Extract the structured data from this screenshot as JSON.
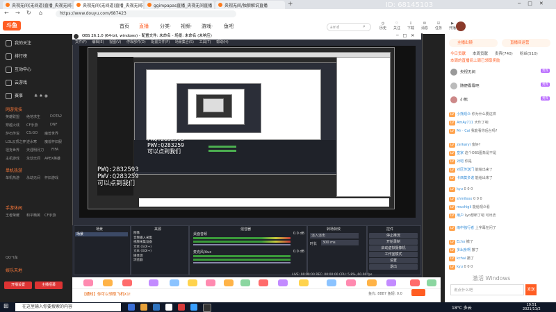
{
  "browser": {
    "tabs": [
      {
        "label": "央视无间(无间道)直播_央视无间视频直播"
      },
      {
        "label": "央视无间(无间道)直播_央视无间视频直播 ×"
      },
      {
        "label": "ggimpapas直播_央视无间直播"
      },
      {
        "label": "央视无间/独狼解说直播"
      }
    ],
    "address": "https://www.douyu.com/687423",
    "watermark": "ID: 68145103"
  },
  "site_header": {
    "logo": "斗鱼",
    "nav": [
      "首页",
      "直播",
      "分类·",
      "视频·",
      "游戏·",
      "鱼吧"
    ],
    "active_nav": "直播",
    "search_placeholder": "amd",
    "icons": [
      "历史",
      "关注",
      "下载",
      "消息",
      "任务",
      "开播"
    ]
  },
  "sidebar": {
    "items": [
      "我的关注",
      "排行榜",
      "互动中心",
      "云游戏",
      "赛事"
    ],
    "heads": [
      "网游竞技",
      "单机热游",
      "手游休闲",
      "娱乐天地"
    ],
    "games": [
      "英雄联盟",
      "绝地求生",
      "DOTA2",
      "穿越火线",
      "CF手游",
      "DNF",
      "炉石传说",
      "CS:GO",
      "魔兽世界",
      "LOL云顶之弈",
      "逆水寒",
      "魔兽怀旧服",
      "坦克世界",
      "天涯明月刀",
      "FIFA",
      "主机游戏",
      "永劫无间",
      "怀旧游戏",
      "APEX英雄",
      "单机热游",
      "CF手游",
      "和平精英",
      "王者荣耀",
      "QQ飞车"
    ],
    "buttons": [
      "开播设置",
      "主播招募"
    ]
  },
  "obs": {
    "title": "OBS 26.1.0 (64-bit, windows) - 配置文件: 未命名 - 场景: 未命名",
    "menu": [
      "文件(F)",
      "编辑(E)",
      "视图(V)",
      "停靠部件(D)",
      "配置文件(P)",
      "场景集合(S)",
      "工具(T)",
      "帮助(H)"
    ],
    "dock_titles": [
      "场景",
      "来源",
      "混音器",
      "转场特效",
      "控件"
    ],
    "scene": "场景",
    "sources": [
      "图像",
      "音频输入采集",
      "视频采集设备",
      "文本 (GDI+)",
      "文本 (GDI+)",
      "媒体源",
      "浏览器"
    ],
    "mixer": [
      {
        "name": "桌面音频",
        "level": "0.0 dB"
      },
      {
        "name": "麦克风/Aux",
        "level": "0.0 dB"
      }
    ],
    "transition": "淡入淡出",
    "duration_label": "时长",
    "duration": "300 ms",
    "controls": [
      "停止推流",
      "开始录制",
      "启动虚拟摄像机",
      "工作室模式",
      "设置",
      "退出"
    ],
    "status": "LIVE: 00:00:00  REC: 00:00:00  CPU: 5.8%, 60.00 fps",
    "not_responding": "(未响应)"
  },
  "overlay": {
    "lines": [
      "PWQ:2832593",
      "PWV:Q283259",
      "可以点到我们"
    ]
  },
  "chat": {
    "top_tabs": [
      "主播出镜",
      "直播间运营"
    ],
    "tabs": [
      "今日贡献",
      "本周贡献",
      "贵宾(740)",
      "粉丝(510)"
    ],
    "active_tab": "今日贡献",
    "ranks": [
      {
        "name": "本周的直播间上周已领取奖励",
        "level": "头部"
      },
      {
        "name": "央视无间",
        "level": "贵宾"
      },
      {
        "name": "随便看看吧",
        "level": "贵宾"
      },
      {
        "name": "小熊",
        "level": "贵宾"
      }
    ],
    "messages": [
      {
        "badge": "LV",
        "user": "小熊观众",
        "text": "你为什么要这样"
      },
      {
        "badge": "LV",
        "user": "AmAy711",
        "text": "大伙了吧"
      },
      {
        "badge": "LV",
        "user": "Mr · Cai",
        "text": "我能看你后台吗?"
      },
      {
        "badge": "LV",
        "user": "zerkaryi",
        "text": "蛮好?"
      },
      {
        "badge": "LV",
        "user": "皇家",
        "text": "这个OBS图象是不是"
      },
      {
        "badge": "LV",
        "user": "对吧",
        "text": "你是"
      },
      {
        "badge": "LV",
        "user": "对区传送门",
        "text": "能给出来了"
      },
      {
        "badge": "LV",
        "user": "卡西莫多诺",
        "text": "能给出来了"
      },
      {
        "badge": "LV",
        "user": "kyu",
        "text": "0 0 0"
      },
      {
        "badge": "LV",
        "user": "shmilxxx",
        "text": "0 0 0"
      },
      {
        "badge": "LV",
        "user": "mushigli",
        "text": "能给观众看"
      },
      {
        "badge": "LV",
        "user": "用户",
        "text": "Lyo想断了吧 可出去"
      },
      {
        "badge": "LV",
        "user": "雨中独行者",
        "text": "上字幕在问了"
      },
      {
        "badge": "LV",
        "user": "Echo",
        "text": "撤了"
      },
      {
        "badge": "LV",
        "user": "多出身啊",
        "text": "撤了"
      },
      {
        "badge": "LV",
        "user": "kchai",
        "text": "撤了"
      },
      {
        "badge": "LV",
        "user": "kyu",
        "text": "0 0 0"
      }
    ],
    "input_placeholder": "说点什么吧",
    "send": "发送",
    "windows_watermark": "激活 Windows"
  },
  "bottom": {
    "notice": "【通知】你可以领取飞机X1!",
    "stats": "鱼丸: 8887   鱼翅: 0.0"
  },
  "taskbar": {
    "search": "在这里输入你要搜索的内容",
    "temp": "18°C 多云",
    "time": "19:51",
    "date": "2021/11/2"
  }
}
